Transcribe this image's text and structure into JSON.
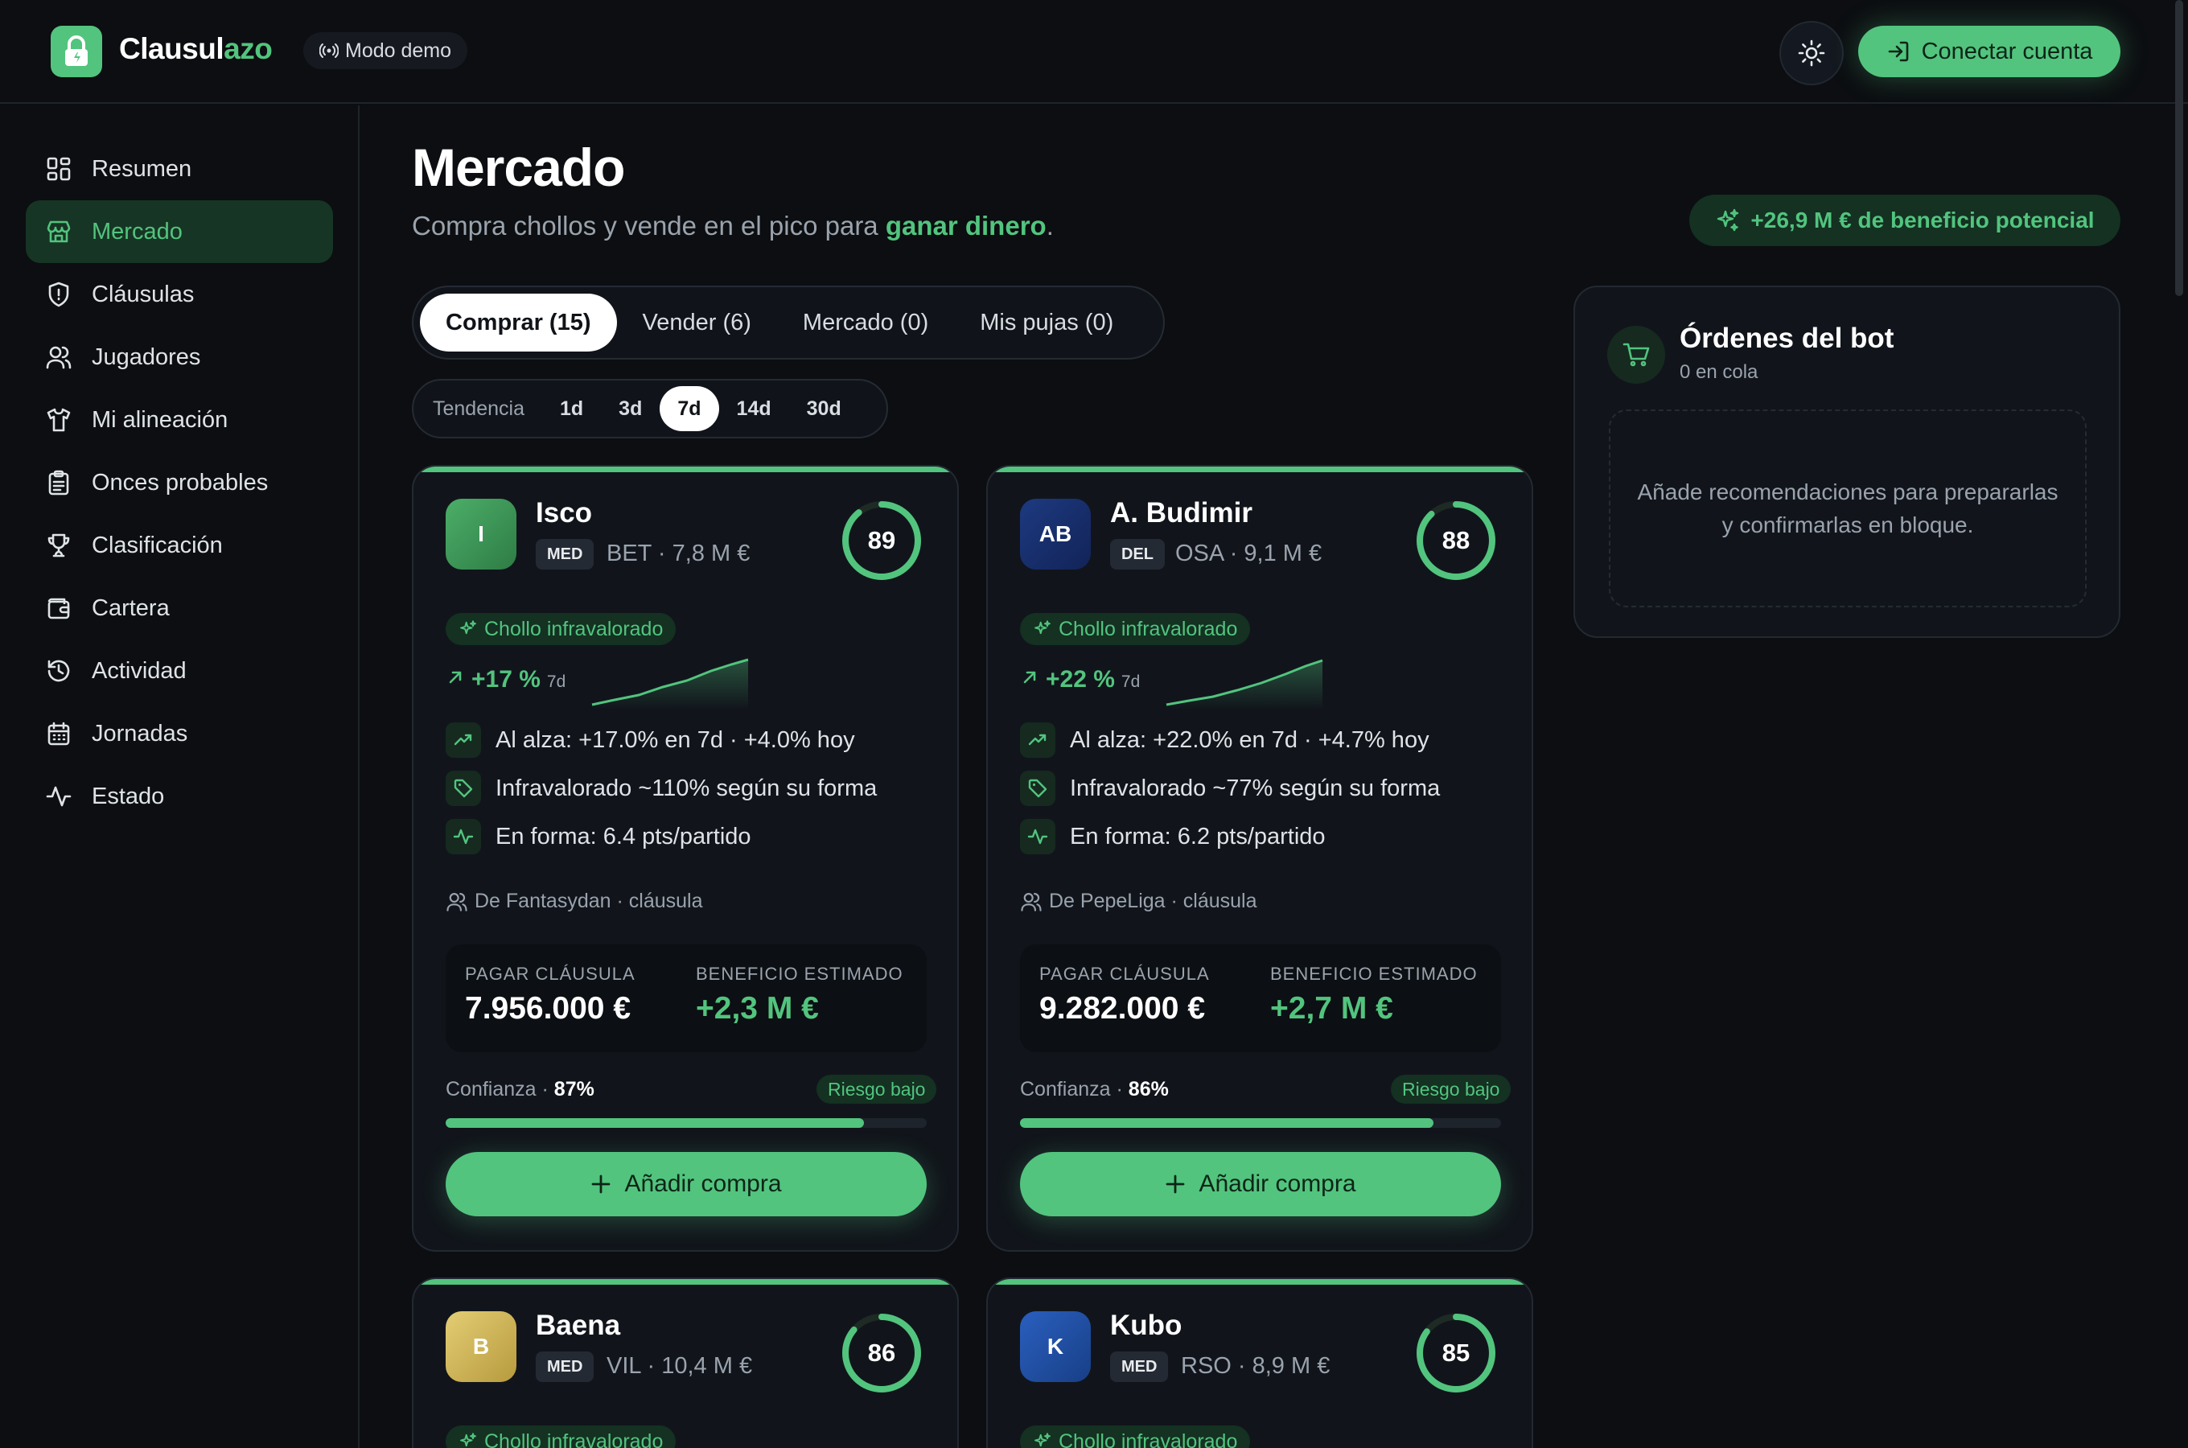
{
  "header": {
    "brand_main": "Clausul",
    "brand_accent": "azo",
    "demo_label": "Modo demo",
    "connect_label": "Conectar cuenta"
  },
  "sidebar": {
    "items": [
      {
        "label": "Resumen",
        "icon": "grid-icon"
      },
      {
        "label": "Mercado",
        "icon": "store-icon",
        "active": true
      },
      {
        "label": "Cláusulas",
        "icon": "shield-icon"
      },
      {
        "label": "Jugadores",
        "icon": "users-icon"
      },
      {
        "label": "Mi alineación",
        "icon": "shirt-icon"
      },
      {
        "label": "Onces probables",
        "icon": "clipboard-icon"
      },
      {
        "label": "Clasificación",
        "icon": "trophy-icon"
      },
      {
        "label": "Cartera",
        "icon": "wallet-icon"
      },
      {
        "label": "Actividad",
        "icon": "history-icon"
      },
      {
        "label": "Jornadas",
        "icon": "calendar-icon"
      },
      {
        "label": "Estado",
        "icon": "activity-icon"
      }
    ]
  },
  "main": {
    "title": "Mercado",
    "subtitle_prefix": "Compra chollos y vende en el pico para ",
    "subtitle_highlight": "ganar dinero",
    "subtitle_suffix": ".",
    "profit_pill": "+26,9 M € de beneficio potencial",
    "tabs": [
      {
        "label": "Comprar (15)",
        "active": true
      },
      {
        "label": "Vender (6)"
      },
      {
        "label": "Mercado (0)"
      },
      {
        "label": "Mis pujas (0)"
      }
    ],
    "trend": {
      "label": "Tendencia",
      "options": [
        "1d",
        "3d",
        "7d",
        "14d",
        "30d"
      ],
      "selected": "7d"
    }
  },
  "cards": [
    {
      "initials": "I",
      "name": "Isco",
      "pos": "MED",
      "team": "BET · 7,8 M €",
      "score": "89",
      "score_value": 89,
      "tag": "Chollo infravalorado",
      "pct": "+17 %",
      "period": "7d",
      "reasons": [
        "Al alza: +17.0% en 7d · +4.0% hoy",
        "Infravalorado ~110% según su forma",
        "En forma: 6.4 pts/partido"
      ],
      "from": "De Fantasydan · cláusula",
      "pay_label": "PAGAR CLÁUSULA",
      "pay_value": "7.956.000 €",
      "profit_label": "BENEFICIO ESTIMADO",
      "profit_value": "+2,3 M €",
      "conf_label": "Confianza · ",
      "conf_value": "87%",
      "confidence": 87,
      "risk": "Riesgo bajo",
      "add_label": "Añadir compra"
    },
    {
      "initials": "AB",
      "name": "A. Budimir",
      "pos": "DEL",
      "team": "OSA · 9,1 M €",
      "score": "88",
      "score_value": 88,
      "tag": "Chollo infravalorado",
      "pct": "+22 %",
      "period": "7d",
      "reasons": [
        "Al alza: +22.0% en 7d · +4.7% hoy",
        "Infravalorado ~77% según su forma",
        "En forma: 6.2 pts/partido"
      ],
      "from": "De PepeLiga · cláusula",
      "pay_label": "PAGAR CLÁUSULA",
      "pay_value": "9.282.000 €",
      "profit_label": "BENEFICIO ESTIMADO",
      "profit_value": "+2,7 M €",
      "conf_label": "Confianza · ",
      "conf_value": "86%",
      "confidence": 86,
      "risk": "Riesgo bajo",
      "add_label": "Añadir compra"
    },
    {
      "initials": "B",
      "name": "Baena",
      "pos": "MED",
      "team": "VIL · 10,4 M €",
      "score": "86",
      "score_value": 86,
      "tag": "Chollo infravalorado"
    },
    {
      "initials": "K",
      "name": "Kubo",
      "pos": "MED",
      "team": "RSO · 8,9 M €",
      "score": "85",
      "score_value": 85,
      "tag": "Chollo infravalorado"
    }
  ],
  "orders": {
    "title": "Órdenes del bot",
    "subtitle": "0 en cola",
    "empty_text": "Añade recomendaciones para prepararlas y confirmarlas en bloque."
  },
  "colors": {
    "accent": "#52c47e",
    "background": "#0c0e11",
    "card": "#11151b",
    "isco_avatar": "#3e9a5a",
    "budimir_avatar": "#1a2f6a",
    "baena_avatar": "#d4b95a",
    "kubo_avatar": "#1f4ea0"
  }
}
